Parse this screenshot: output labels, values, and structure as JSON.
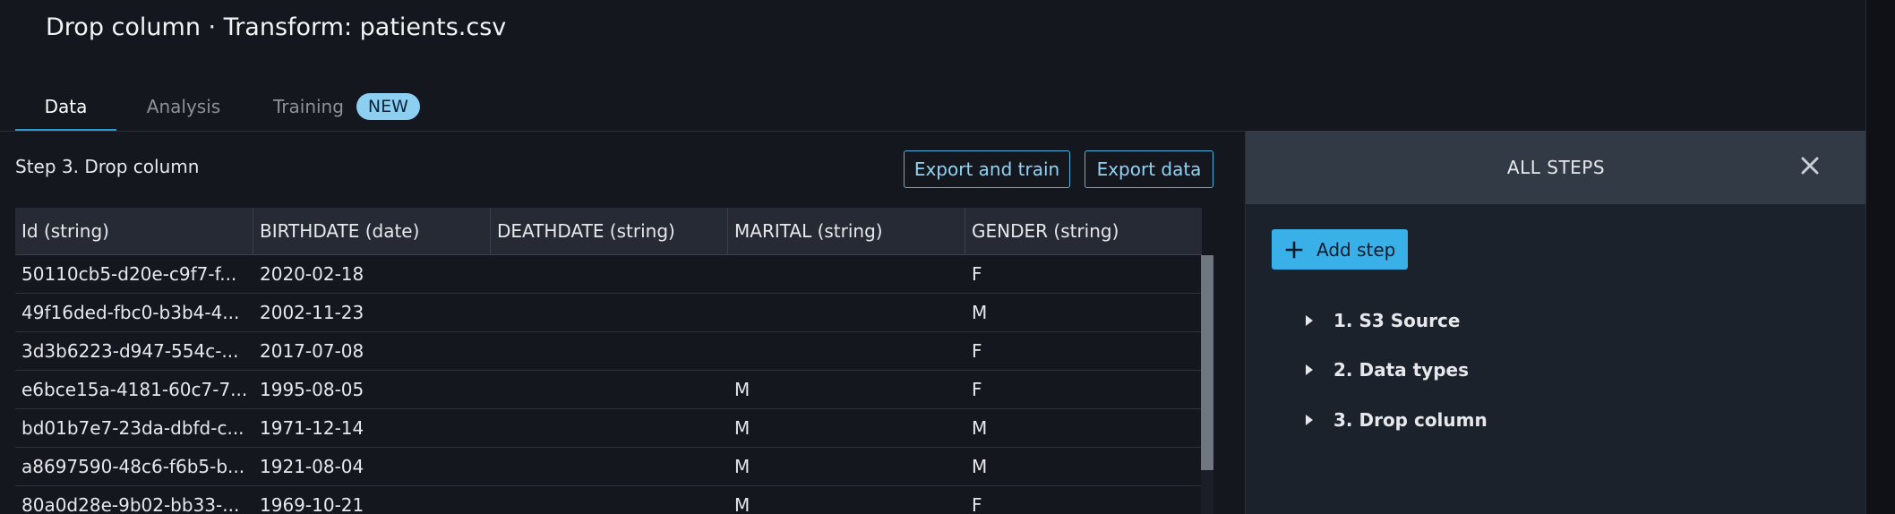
{
  "header": {
    "title": "Drop column · Transform: patients.csv"
  },
  "tabs": [
    {
      "label": "Data",
      "active": true
    },
    {
      "label": "Analysis",
      "active": false
    },
    {
      "label": "Training",
      "active": false,
      "badge": "NEW"
    }
  ],
  "main": {
    "step_label": "Step 3. Drop column",
    "export_and_train_label": "Export and train",
    "export_data_label": "Export data",
    "table": {
      "columns": [
        "Id (string)",
        "BIRTHDATE (date)",
        "DEATHDATE (string)",
        "MARITAL (string)",
        "GENDER (string)"
      ],
      "rows": [
        [
          "50110cb5-d20e-c9f7-f...",
          "2020-02-18",
          "",
          "",
          "F"
        ],
        [
          "49f16ded-fbc0-b3b4-4...",
          "2002-11-23",
          "",
          "",
          "M"
        ],
        [
          "3d3b6223-d947-554c-...",
          "2017-07-08",
          "",
          "",
          "F"
        ],
        [
          "e6bce15a-4181-60c7-7...",
          "1995-08-05",
          "",
          "M",
          "F"
        ],
        [
          "bd01b7e7-23da-dbfd-c...",
          "1971-12-14",
          "",
          "M",
          "M"
        ],
        [
          "a8697590-48c6-f6b5-b...",
          "1921-08-04",
          "",
          "M",
          "M"
        ],
        [
          "80a0d28e-9b02-bb33-...",
          "1969-10-21",
          "",
          "M",
          "F"
        ]
      ]
    }
  },
  "steps_panel": {
    "title": "ALL STEPS",
    "add_step_label": "Add step",
    "steps": [
      "1. S3 Source",
      "2. Data types",
      "3. Drop column"
    ]
  },
  "colors": {
    "background": "#15171f",
    "accent": "#3ab0e8",
    "badge": "#8ccff0",
    "panel": "#1c222b",
    "panel_header": "#323a45"
  },
  "icons": {
    "close": "close-icon",
    "add": "plus-icon",
    "expand": "caret-right-icon"
  }
}
